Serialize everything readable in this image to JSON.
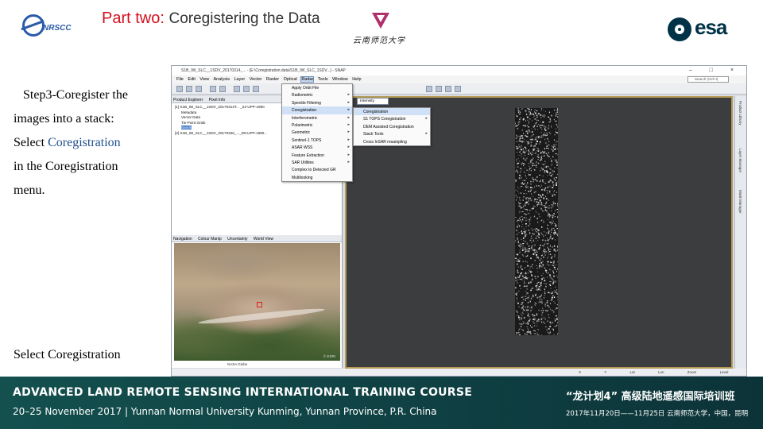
{
  "slide": {
    "title_part": "Part two:",
    "title_rest": "Coregistering the Data",
    "logos": {
      "left": "NRSCC",
      "middle_cn": "云南师范大学",
      "right": "esa"
    }
  },
  "left_text": {
    "line1": "Step3-Coregister the",
    "line2": "images into a stack:",
    "select_word": "Select",
    "coreg_word1": "Coregistration",
    "in_the": "in the",
    "coreg_word2": "Coregistration",
    "menu_word": "menu.",
    "caption": "Select Coregistration"
  },
  "app": {
    "window_title": "S1B_IW_SLC__1SDV_20170314_... - [E:\\Coregistration.data\\S1B_IW_SLC_1SDV...] - SNAP",
    "window_buttons": "– □ ×",
    "menus": [
      "File",
      "Edit",
      "View",
      "Analysis",
      "Layer",
      "Vector",
      "Raster",
      "Optical",
      "Radar",
      "Tools",
      "Window",
      "Help"
    ],
    "search_placeholder": "Search (Ctrl+I)",
    "left_tabs": [
      "Product Explorer",
      "Pixel Info"
    ],
    "tree_items": [
      "[1] S1B_IW_SLC__1SDV_20170314T... _22-UPP-1990",
      "Metadata",
      "Vector Data",
      "Tie-Point Grids",
      "Bands",
      "[2] S1B_IW_SLC__1SDV_20170326_..._D5-UPP-1990..."
    ],
    "bottom_tabs": [
      "Navigation",
      "Colour Manip",
      "Uncertainty",
      "World View"
    ],
    "map_credit": "© ESRI",
    "map_label": "NASA Globe",
    "radar_menu": [
      {
        "label": "Apply Orbit File",
        "arrow": false,
        "highlight": false
      },
      {
        "label": "Radiometric",
        "arrow": true,
        "highlight": false
      },
      {
        "label": "Speckle Filtering",
        "arrow": true,
        "highlight": false
      },
      {
        "label": "Coregistration",
        "arrow": true,
        "highlight": true
      },
      {
        "label": "Interferometric",
        "arrow": true,
        "highlight": false
      },
      {
        "label": "Polarimetric",
        "arrow": true,
        "highlight": false
      },
      {
        "label": "Geometric",
        "arrow": true,
        "highlight": false
      },
      {
        "label": "Sentinel-1 TOPS",
        "arrow": true,
        "highlight": false
      },
      {
        "label": "ASAR WSS",
        "arrow": true,
        "highlight": false
      },
      {
        "label": "Feature Extraction",
        "arrow": true,
        "highlight": false
      },
      {
        "label": "SAR Utilities",
        "arrow": true,
        "highlight": false
      },
      {
        "label": "Complex to Detected GR",
        "arrow": false,
        "highlight": false
      },
      {
        "label": "Multilooking",
        "arrow": false,
        "highlight": false
      }
    ],
    "dropdown_value": "Intensity",
    "coreg_submenu": [
      {
        "label": "Coregistration",
        "arrow": false,
        "highlight": true
      },
      {
        "label": "S1 TOPS Coregistration",
        "arrow": true,
        "highlight": false
      },
      {
        "label": "DEM Assisted Coregistration",
        "arrow": false,
        "highlight": false
      },
      {
        "label": "Stack Tools",
        "arrow": true,
        "highlight": false
      },
      {
        "label": "Cross InSAR resampling",
        "arrow": false,
        "highlight": false
      }
    ],
    "right_dock": [
      "Product Library",
      "Layer Manager",
      "Mask Manager"
    ],
    "status": [
      "X",
      "Y",
      "Lat",
      "Lon",
      "Zoom",
      "Level"
    ]
  },
  "footer": {
    "title": "ADVANCED LAND REMOTE SENSING INTERNATIONAL TRAINING COURSE",
    "subtitle": "20–25 November 2017 | Yunnan Normal University Kunming, Yunnan Province, P.R. China",
    "title_cn": "“龙计划4” 高级陆地遥感国际培训班",
    "subtitle_cn": "2017年11月20日——11月25日  云南师范大学，中国，昆明"
  },
  "colors": {
    "title_red": "#d4101e",
    "footer_teal": "#124a4a",
    "highlight_blue": "#cfe0f7",
    "view_border": "#b59b55"
  }
}
